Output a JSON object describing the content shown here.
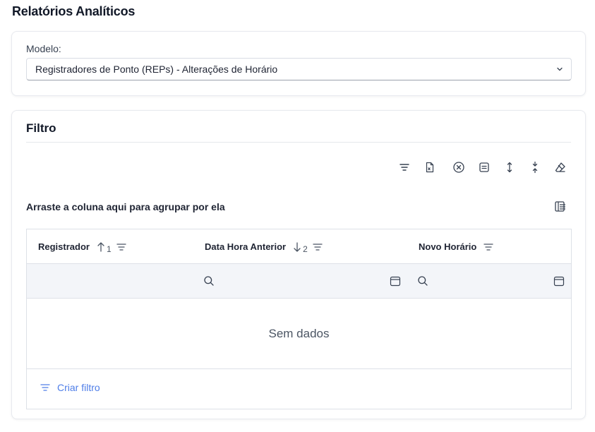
{
  "page": {
    "title": "Relatórios Analíticos"
  },
  "model": {
    "label": "Modelo:",
    "selected": "Registradores de Ponto (REPs) - Alterações de Horário"
  },
  "filter": {
    "title": "Filtro",
    "group_hint": "Arraste a coluna aqui para agrupar por ela",
    "columns": [
      {
        "label": "Registrador",
        "sort_dir": "asc",
        "sort_index": "1"
      },
      {
        "label": "Data Hora Anterior",
        "sort_dir": "desc",
        "sort_index": "2"
      },
      {
        "label": "Novo Horário"
      }
    ],
    "empty_text": "Sem dados",
    "create_filter_label": "Criar filtro"
  },
  "toolbar_icons": [
    "filter-icon",
    "export-excel-icon",
    "clear-icon",
    "layout-icon",
    "expand-icon",
    "collapse-icon",
    "eraser-icon"
  ],
  "colors": {
    "accent": "#4f7ee8",
    "border": "#dde1e7",
    "filter_row_bg": "#f3f5f9",
    "text": "#1f2433"
  }
}
